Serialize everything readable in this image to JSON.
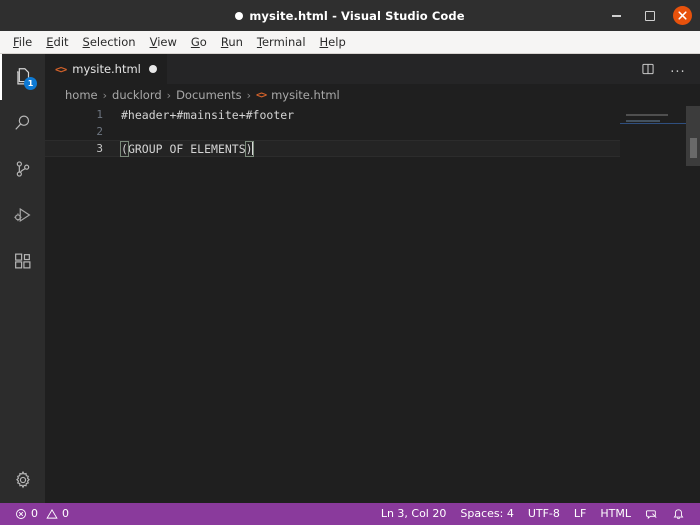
{
  "window": {
    "title": "mysite.html - Visual Studio Code",
    "dirty_indicator": "●",
    "controls": {
      "minimize": "minimize-button",
      "maximize": "maximize-button",
      "close": "close-button"
    }
  },
  "menubar": {
    "items": [
      {
        "mnemonic": "F",
        "rest": "ile"
      },
      {
        "mnemonic": "E",
        "rest": "dit"
      },
      {
        "mnemonic": "S",
        "rest": "election"
      },
      {
        "mnemonic": "V",
        "rest": "iew"
      },
      {
        "mnemonic": "G",
        "rest": "o"
      },
      {
        "mnemonic": "R",
        "rest": "un"
      },
      {
        "mnemonic": "T",
        "rest": "erminal"
      },
      {
        "mnemonic": "H",
        "rest": "elp"
      }
    ]
  },
  "activitybar": {
    "items": [
      {
        "name": "explorer",
        "label": "Explorer",
        "badge": "1"
      },
      {
        "name": "search",
        "label": "Search",
        "badge": ""
      },
      {
        "name": "source-control",
        "label": "Source Control",
        "badge": ""
      },
      {
        "name": "run-debug",
        "label": "Run and Debug",
        "badge": ""
      },
      {
        "name": "extensions",
        "label": "Extensions",
        "badge": ""
      }
    ],
    "bottom": {
      "name": "manage",
      "label": "Manage"
    }
  },
  "tabs": {
    "items": [
      {
        "icon": "<>",
        "label": "mysite.html",
        "dirty": true
      }
    ],
    "actions": {
      "split": "split-editor",
      "more": "..."
    }
  },
  "breadcrumbs": {
    "items": [
      "home",
      "ducklord",
      "Documents"
    ],
    "separator": "›",
    "file_icon": "<>",
    "file": "mysite.html"
  },
  "editor": {
    "lines": [
      {
        "number": "1",
        "text": "#header+#mainsite+#footer",
        "current": false
      },
      {
        "number": "2",
        "text": "",
        "current": false
      },
      {
        "number": "3",
        "text": "(GROUP OF ELEMENTS)",
        "current": true
      }
    ],
    "line3": {
      "open_bracket": "(",
      "inner": "GROUP OF ELEMENTS",
      "close_bracket": ")"
    }
  },
  "statusbar": {
    "errors": "0",
    "warnings": "0",
    "position": "Ln 3, Col 20",
    "indentation": "Spaces: 4",
    "encoding": "UTF-8",
    "eol": "LF",
    "language": "HTML",
    "feedback": "feedback-icon",
    "notifications": "bell-icon"
  },
  "colors": {
    "titlebar_bg": "#2f2f2f",
    "menubar_bg": "#f6f5f4",
    "activitybar_bg": "#2c2c2c",
    "editor_bg": "#1f1f1f",
    "statusbar_bg": "#8a3a9c",
    "badge_bg": "#0e7ad4",
    "close_bg": "#e8520c",
    "html_icon": "#d4622a"
  }
}
